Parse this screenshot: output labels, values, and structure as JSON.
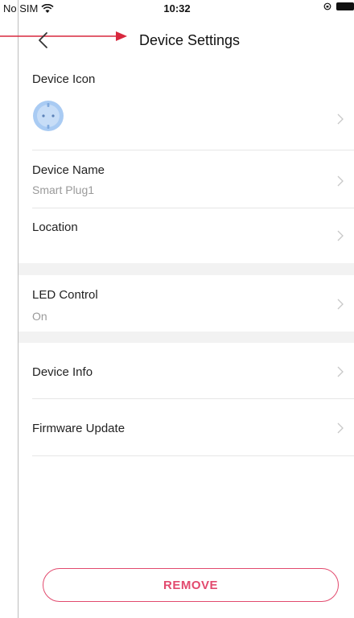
{
  "status_bar": {
    "carrier": "No SIM",
    "time": "10:32"
  },
  "nav": {
    "title": "Device Settings"
  },
  "rows": {
    "device_icon": {
      "label": "Device Icon"
    },
    "device_name": {
      "label": "Device Name",
      "value": "Smart Plug1"
    },
    "location": {
      "label": "Location"
    },
    "led_control": {
      "label": "LED Control",
      "value": "On"
    },
    "device_info": {
      "label": "Device Info"
    },
    "firmware_update": {
      "label": "Firmware Update"
    }
  },
  "remove_button": {
    "label": "REMOVE"
  },
  "colors": {
    "accent": "#e24a6e",
    "annotation_arrow": "#d8283e",
    "plug_blue": "#a9cbf3"
  }
}
